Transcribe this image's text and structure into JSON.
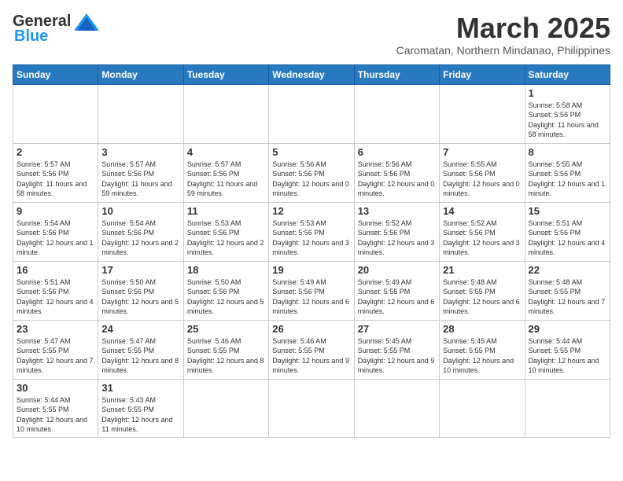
{
  "header": {
    "logo_general": "General",
    "logo_blue": "Blue",
    "month_title": "March 2025",
    "location": "Caromatan, Northern Mindanao, Philippines"
  },
  "days_of_week": [
    "Sunday",
    "Monday",
    "Tuesday",
    "Wednesday",
    "Thursday",
    "Friday",
    "Saturday"
  ],
  "weeks": [
    [
      {
        "day": "",
        "info": ""
      },
      {
        "day": "",
        "info": ""
      },
      {
        "day": "",
        "info": ""
      },
      {
        "day": "",
        "info": ""
      },
      {
        "day": "",
        "info": ""
      },
      {
        "day": "",
        "info": ""
      },
      {
        "day": "1",
        "info": "Sunrise: 5:58 AM\nSunset: 5:56 PM\nDaylight: 11 hours and 58 minutes."
      }
    ],
    [
      {
        "day": "2",
        "info": "Sunrise: 5:57 AM\nSunset: 5:56 PM\nDaylight: 11 hours and 58 minutes."
      },
      {
        "day": "3",
        "info": "Sunrise: 5:57 AM\nSunset: 5:56 PM\nDaylight: 11 hours and 59 minutes."
      },
      {
        "day": "4",
        "info": "Sunrise: 5:57 AM\nSunset: 5:56 PM\nDaylight: 11 hours and 59 minutes."
      },
      {
        "day": "5",
        "info": "Sunrise: 5:56 AM\nSunset: 5:56 PM\nDaylight: 12 hours and 0 minutes."
      },
      {
        "day": "6",
        "info": "Sunrise: 5:56 AM\nSunset: 5:56 PM\nDaylight: 12 hours and 0 minutes."
      },
      {
        "day": "7",
        "info": "Sunrise: 5:55 AM\nSunset: 5:56 PM\nDaylight: 12 hours and 0 minutes."
      },
      {
        "day": "8",
        "info": "Sunrise: 5:55 AM\nSunset: 5:56 PM\nDaylight: 12 hours and 1 minute."
      }
    ],
    [
      {
        "day": "9",
        "info": "Sunrise: 5:54 AM\nSunset: 5:56 PM\nDaylight: 12 hours and 1 minute."
      },
      {
        "day": "10",
        "info": "Sunrise: 5:54 AM\nSunset: 5:56 PM\nDaylight: 12 hours and 2 minutes."
      },
      {
        "day": "11",
        "info": "Sunrise: 5:53 AM\nSunset: 5:56 PM\nDaylight: 12 hours and 2 minutes."
      },
      {
        "day": "12",
        "info": "Sunrise: 5:53 AM\nSunset: 5:56 PM\nDaylight: 12 hours and 3 minutes."
      },
      {
        "day": "13",
        "info": "Sunrise: 5:52 AM\nSunset: 5:56 PM\nDaylight: 12 hours and 3 minutes."
      },
      {
        "day": "14",
        "info": "Sunrise: 5:52 AM\nSunset: 5:56 PM\nDaylight: 12 hours and 3 minutes."
      },
      {
        "day": "15",
        "info": "Sunrise: 5:51 AM\nSunset: 5:56 PM\nDaylight: 12 hours and 4 minutes."
      }
    ],
    [
      {
        "day": "16",
        "info": "Sunrise: 5:51 AM\nSunset: 5:56 PM\nDaylight: 12 hours and 4 minutes."
      },
      {
        "day": "17",
        "info": "Sunrise: 5:50 AM\nSunset: 5:56 PM\nDaylight: 12 hours and 5 minutes."
      },
      {
        "day": "18",
        "info": "Sunrise: 5:50 AM\nSunset: 5:56 PM\nDaylight: 12 hours and 5 minutes."
      },
      {
        "day": "19",
        "info": "Sunrise: 5:49 AM\nSunset: 5:56 PM\nDaylight: 12 hours and 6 minutes."
      },
      {
        "day": "20",
        "info": "Sunrise: 5:49 AM\nSunset: 5:55 PM\nDaylight: 12 hours and 6 minutes."
      },
      {
        "day": "21",
        "info": "Sunrise: 5:48 AM\nSunset: 5:55 PM\nDaylight: 12 hours and 6 minutes."
      },
      {
        "day": "22",
        "info": "Sunrise: 5:48 AM\nSunset: 5:55 PM\nDaylight: 12 hours and 7 minutes."
      }
    ],
    [
      {
        "day": "23",
        "info": "Sunrise: 5:47 AM\nSunset: 5:55 PM\nDaylight: 12 hours and 7 minutes."
      },
      {
        "day": "24",
        "info": "Sunrise: 5:47 AM\nSunset: 5:55 PM\nDaylight: 12 hours and 8 minutes."
      },
      {
        "day": "25",
        "info": "Sunrise: 5:46 AM\nSunset: 5:55 PM\nDaylight: 12 hours and 8 minutes."
      },
      {
        "day": "26",
        "info": "Sunrise: 5:46 AM\nSunset: 5:55 PM\nDaylight: 12 hours and 9 minutes."
      },
      {
        "day": "27",
        "info": "Sunrise: 5:45 AM\nSunset: 5:55 PM\nDaylight: 12 hours and 9 minutes."
      },
      {
        "day": "28",
        "info": "Sunrise: 5:45 AM\nSunset: 5:55 PM\nDaylight: 12 hours and 10 minutes."
      },
      {
        "day": "29",
        "info": "Sunrise: 5:44 AM\nSunset: 5:55 PM\nDaylight: 12 hours and 10 minutes."
      }
    ],
    [
      {
        "day": "30",
        "info": "Sunrise: 5:44 AM\nSunset: 5:55 PM\nDaylight: 12 hours and 10 minutes."
      },
      {
        "day": "31",
        "info": "Sunrise: 5:43 AM\nSunset: 5:55 PM\nDaylight: 12 hours and 11 minutes."
      },
      {
        "day": "",
        "info": ""
      },
      {
        "day": "",
        "info": ""
      },
      {
        "day": "",
        "info": ""
      },
      {
        "day": "",
        "info": ""
      },
      {
        "day": "",
        "info": ""
      }
    ]
  ]
}
